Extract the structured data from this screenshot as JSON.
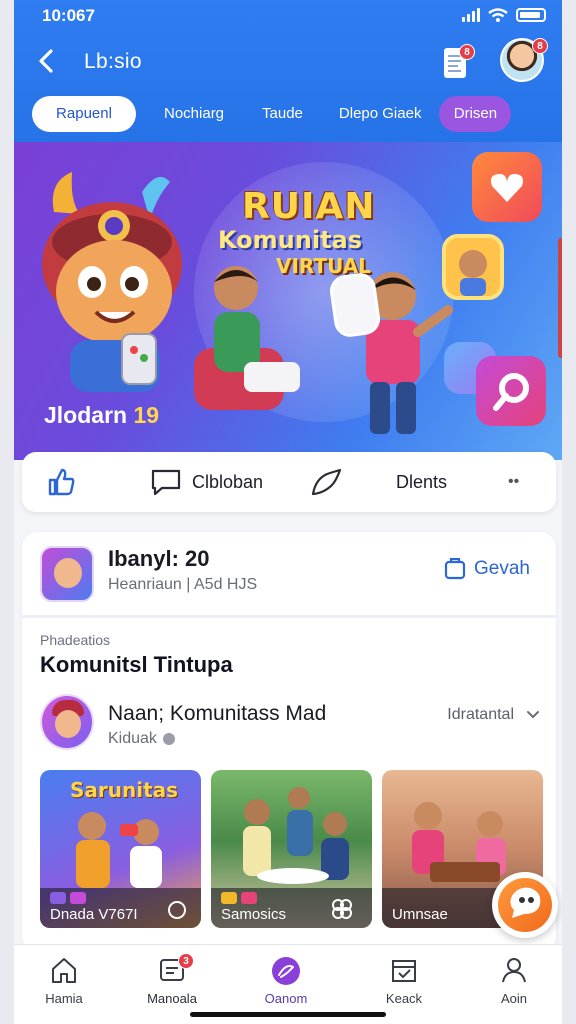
{
  "status_bar": {
    "time": "10:067"
  },
  "header": {
    "title": "Lb:sio",
    "doc_badge": "8",
    "avatar_badge": "8"
  },
  "tabs": [
    {
      "label": "Rapuenl",
      "active": true
    },
    {
      "label": "Nochiarg",
      "active": false
    },
    {
      "label": "Taude",
      "active": false
    },
    {
      "label": "Dlepo Giaek",
      "active": false
    },
    {
      "label": "Drisen",
      "active": false,
      "pill": true
    }
  ],
  "hero": {
    "title": "RUIAN",
    "subtitle": "Komunitas",
    "tagline": "VIRTUAL",
    "caption_text": "Jlodarn",
    "caption_number": "19"
  },
  "actions": {
    "like_icon": "thumbs-up-icon",
    "comment_label": "Clbloban",
    "share_label": "Dlents",
    "more_label": "••"
  },
  "card": {
    "name": "Ibanyl: 20",
    "meta": "Heanriaun | A5d HJS",
    "action_label": "Gevah",
    "section_label": "Phadeatios",
    "section_title": "Komunitsl Tintupa",
    "item": {
      "title": "Naan; Komunitass Mad",
      "subtitle": "Kiduak",
      "right_label": "Idratantal"
    },
    "thumbnails": [
      {
        "title": "Sarunitas",
        "caption": "Dnada V767I"
      },
      {
        "title": "",
        "caption": "Samosics"
      },
      {
        "title": "",
        "caption": "Umnsae"
      }
    ]
  },
  "bottom_nav": [
    {
      "label": "Hamia",
      "icon": "home-icon"
    },
    {
      "label": "Manoala",
      "icon": "notification-icon",
      "badge": "3"
    },
    {
      "label": "Oanom",
      "icon": "discover-icon",
      "active": true
    },
    {
      "label": "Keack",
      "icon": "store-icon"
    },
    {
      "label": "Aoin",
      "icon": "profile-icon"
    }
  ],
  "colors": {
    "header_blue": "#2a77ec",
    "accent_purple": "#8a3fd8",
    "link_blue": "#2d66d6",
    "badge_red": "#e53e4b"
  }
}
